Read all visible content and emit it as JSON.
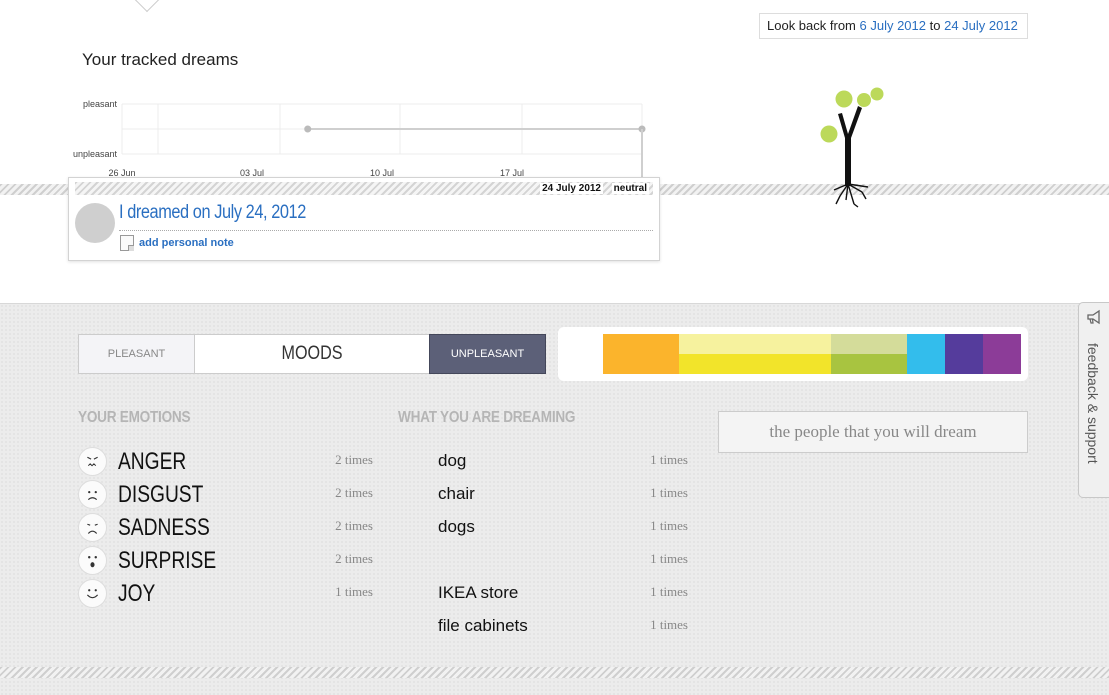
{
  "header": {
    "range_prefix": "Look back from",
    "range_start": "6 July 2012",
    "range_mid": "to",
    "range_end": "24 July 2012"
  },
  "tracked": {
    "title": "Your tracked dreams"
  },
  "chart_data": {
    "type": "line",
    "y_categories": [
      "unpleasant",
      "pleasant"
    ],
    "x_tick_labels": [
      "26 Jun",
      "03 Jul",
      "10 Jul",
      "17 Jul"
    ],
    "xlim": [
      "2012-06-26",
      "2012-07-24"
    ],
    "series": [
      {
        "x": [
          "2012-07-06",
          "2012-07-24"
        ],
        "values": [
          0.5,
          0.5
        ]
      }
    ],
    "grid": true
  },
  "dream_card": {
    "date": "24 July 2012",
    "mood": "neutral",
    "title": "I dreamed on July 24, 2012",
    "note_link": "add personal note"
  },
  "mood_bar": {
    "pleasant_label": "PLEASANT",
    "center_label": "MOODS",
    "unpleasant_label": "UNPLEASANT"
  },
  "mood_colors": [
    {
      "top": "#fbb42c",
      "bottom": "#fbb42c",
      "width": 76
    },
    {
      "top": "#f6f29e",
      "bottom": "#f2e42a",
      "width": 152
    },
    {
      "top": "#d4dc9a",
      "bottom": "#a8c440",
      "width": 76
    },
    {
      "top": "#33bdec",
      "bottom": "#33bdec",
      "width": 38
    },
    {
      "top": "#553c9c",
      "bottom": "#553c9c",
      "width": 38
    },
    {
      "top": "#8c3c98",
      "bottom": "#8c3c98",
      "width": 38
    }
  ],
  "emotions": {
    "heading": "YOUR EMOTIONS",
    "items": [
      {
        "name": "ANGER",
        "count": "2 times",
        "icon": "angry-face-icon"
      },
      {
        "name": "DISGUST",
        "count": "2 times",
        "icon": "frown-face-icon"
      },
      {
        "name": "SADNESS",
        "count": "2 times",
        "icon": "sad-face-icon"
      },
      {
        "name": "SURPRISE",
        "count": "2 times",
        "icon": "surprised-face-icon"
      },
      {
        "name": "JOY",
        "count": "1 times",
        "icon": "smile-face-icon"
      }
    ]
  },
  "dreaming": {
    "heading": "WHAT YOU ARE DREAMING",
    "items": [
      {
        "name": "dog",
        "count": "1 times"
      },
      {
        "name": "chair",
        "count": "1 times"
      },
      {
        "name": "dogs",
        "count": "1 times"
      },
      {
        "name": "",
        "count": "1 times"
      },
      {
        "name": "IKEA store",
        "count": "1 times"
      },
      {
        "name": "file cabinets",
        "count": "1 times"
      }
    ]
  },
  "people": {
    "label": "the people that you will dream"
  },
  "feedback": {
    "label": "feedback & support",
    "icon": "megaphone-icon"
  }
}
